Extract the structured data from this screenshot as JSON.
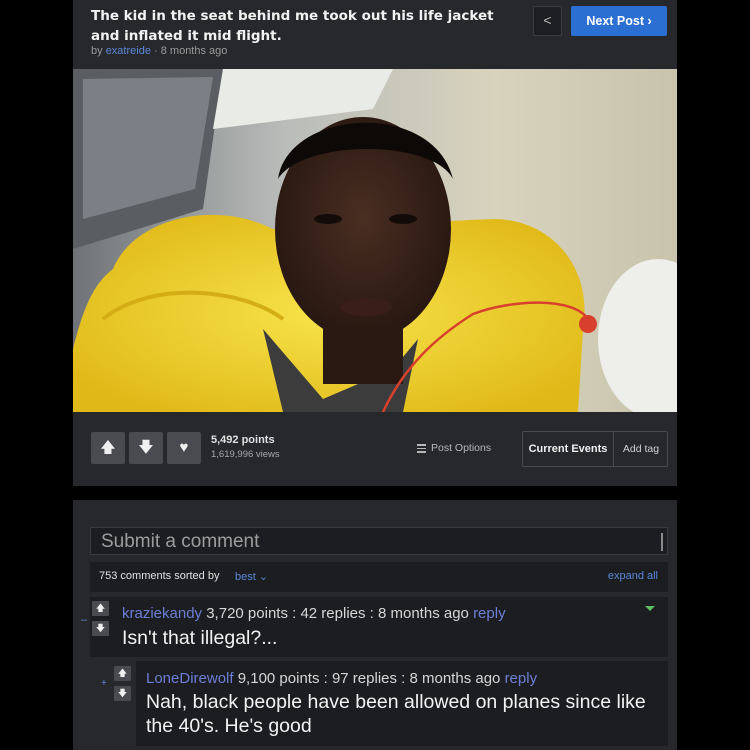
{
  "post": {
    "title": "The kid in the seat behind me took out his life jacket and inflated it mid flight.",
    "by_prefix": "by",
    "author": "exatreide",
    "age": "· 8 months ago",
    "prev_label": "<",
    "next_label": "Next Post ›",
    "points": "5,492 points",
    "views": "1,619,996 views",
    "post_options": "Post Options",
    "tag_primary": "Current Events",
    "tag_add": "Add tag",
    "icons": {
      "upvote": "arrow-up-icon",
      "downvote": "arrow-down-icon",
      "favorite": "heart-icon",
      "options": "menu-icon"
    },
    "vote_glyphs": {
      "up": "🡅",
      "down": "🡇",
      "fav": "♥"
    }
  },
  "comments": {
    "input_placeholder": "Submit a comment",
    "count_text": "753 comments sorted by",
    "sort_value": "best ⌄",
    "expand_all": "expand all",
    "collapse_glyph": "–",
    "expand_glyph": "+",
    "items": [
      {
        "user": "kraziekandy",
        "meta": "3,720 points : 42 replies : 8 months ago",
        "reply": "reply",
        "text": "Isn't that illegal?..."
      },
      {
        "user": "LoneDirewolf",
        "meta": "9,100 points : 97 replies : 8 months ago",
        "reply": "reply",
        "text": "Nah, black people have been allowed on planes since like the 40's. He's good"
      }
    ]
  },
  "colors": {
    "background": "#000000",
    "panel": "#27282c",
    "accent_blue": "#2c6fd3",
    "link_blue": "#5b88d8",
    "life_jacket_yellow": "#f2d12a"
  }
}
